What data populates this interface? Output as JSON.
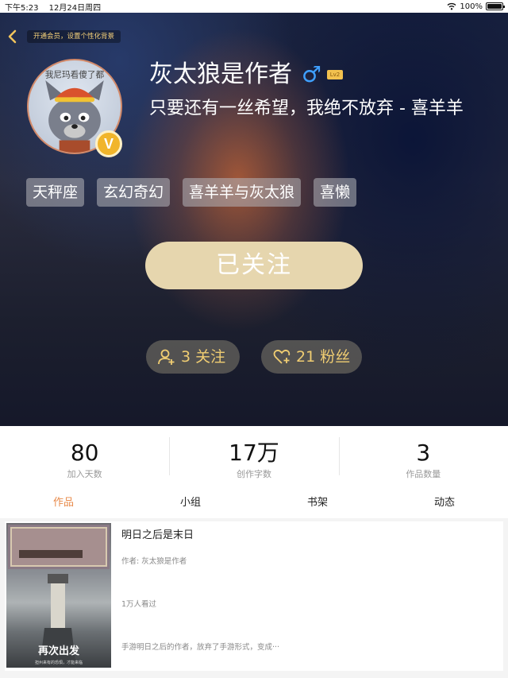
{
  "status_bar": {
    "time": "下午5:23",
    "date": "12月24日周四",
    "battery": "100%",
    "battery_level": 1.0
  },
  "header": {
    "back_icon": "chevron-left-icon",
    "vip_banner": "开通会员，设置个性化背景"
  },
  "profile": {
    "avatar_caption": "我尼玛看傻了都",
    "vip_badge": "V",
    "name": "灰太狼是作者",
    "gender_icon": "male-icon",
    "level": "Lv2",
    "motto": "只要还有一丝希望，我绝不放弃 - 喜羊羊",
    "tags": [
      "天秤座",
      "玄幻奇幻",
      "喜羊羊与灰太狼",
      "喜懒"
    ],
    "follow_button": "已关注",
    "following": "3 关注",
    "fans": "21 粉丝",
    "accent_color": "#f0cd72"
  },
  "stats": [
    {
      "value": "80",
      "label": "加入天数"
    },
    {
      "value": "17万",
      "label": "创作字数"
    },
    {
      "value": "3",
      "label": "作品数量"
    }
  ],
  "tabs": [
    {
      "label": "作品",
      "active": true
    },
    {
      "label": "小组",
      "active": false
    },
    {
      "label": "书架",
      "active": false
    },
    {
      "label": "动态",
      "active": false
    }
  ],
  "book": {
    "title": "明日之后是末日",
    "author": "作者: 灰太狼是作者",
    "reads": "1万人看过",
    "description": "手游明日之后的作者，放弃了手游形式，变成···",
    "cover_text": "再次出发",
    "cover_subtext": "担州来有的恐惧，才能来临"
  }
}
